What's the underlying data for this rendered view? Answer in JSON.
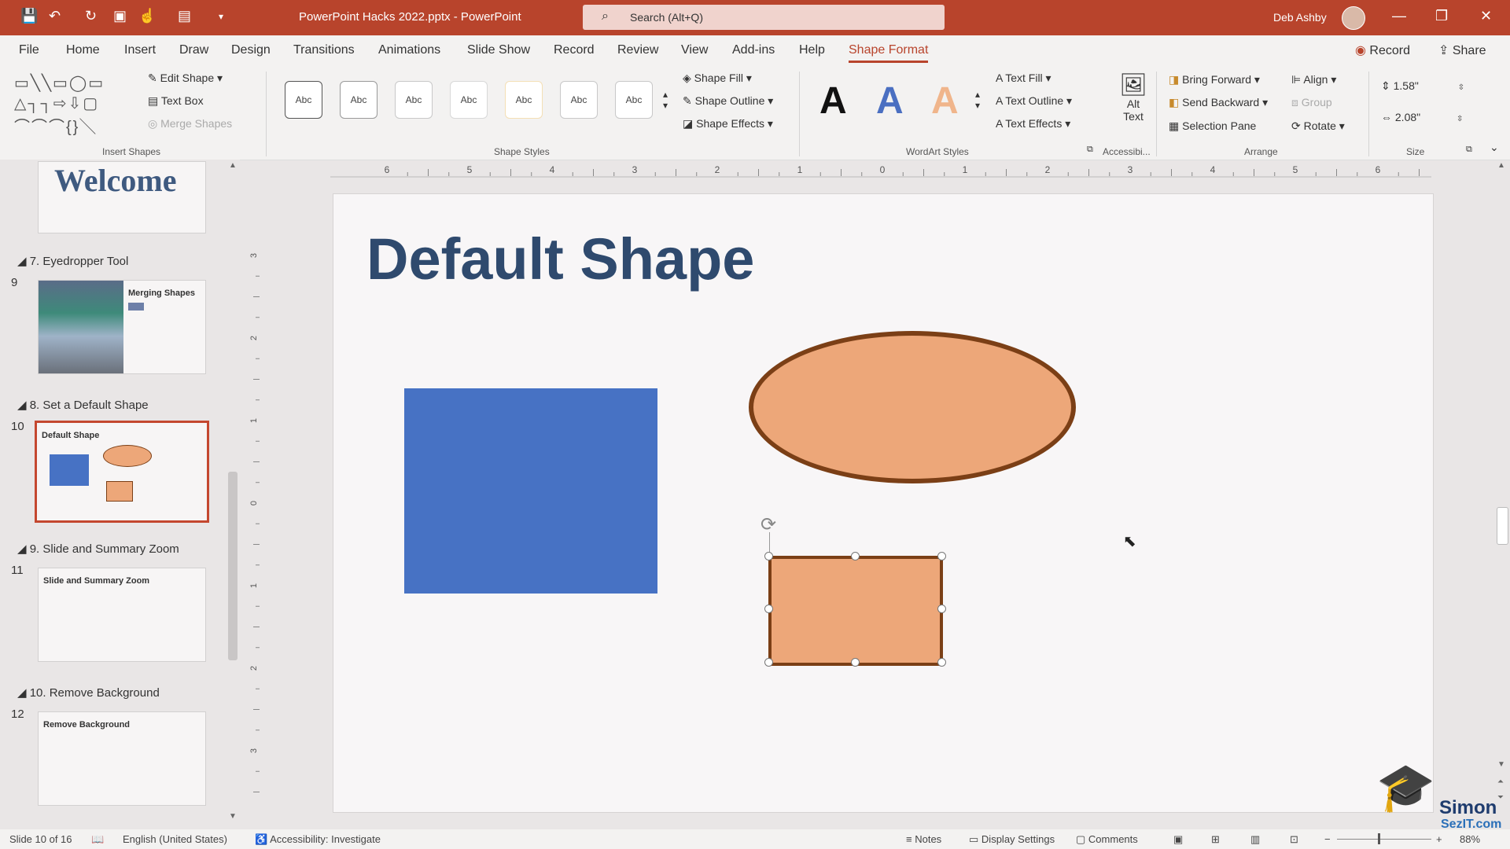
{
  "titlebar": {
    "document_title": "PowerPoint Hacks 2022.pptx  -  PowerPoint",
    "search_placeholder": "Search (Alt+Q)",
    "user_name": "Deb Ashby",
    "minimize": "—",
    "restore": "❐",
    "close": "✕"
  },
  "menu": {
    "items": [
      "File",
      "Home",
      "Insert",
      "Draw",
      "Design",
      "Transitions",
      "Animations",
      "Slide Show",
      "Record",
      "Review",
      "View",
      "Add-ins",
      "Help",
      "Shape Format"
    ],
    "active": "Shape Format",
    "record_label": "Record",
    "share_label": "Share"
  },
  "ribbon": {
    "insert_shapes": {
      "label": "Insert Shapes",
      "edit_shape": "Edit Shape",
      "text_box": "Text Box",
      "merge_shapes": "Merge Shapes"
    },
    "shape_styles": {
      "label": "Shape Styles",
      "sample": "Abc",
      "shape_fill": "Shape Fill",
      "shape_outline": "Shape Outline",
      "shape_effects": "Shape Effects"
    },
    "wordart": {
      "label": "WordArt Styles",
      "letter": "A",
      "text_fill": "Text Fill",
      "text_outline": "Text Outline",
      "text_effects": "Text Effects"
    },
    "accessibility": {
      "label": "Accessibi...",
      "alt_text_line1": "Alt",
      "alt_text_line2": "Text"
    },
    "arrange": {
      "label": "Arrange",
      "bring_forward": "Bring Forward",
      "send_backward": "Send Backward",
      "selection_pane": "Selection Pane",
      "align": "Align",
      "group": "Group",
      "rotate": "Rotate"
    },
    "size": {
      "label": "Size",
      "height": "1.58\"",
      "width": "2.08\""
    }
  },
  "slides_panel": {
    "first_thumb_text": "Welcome",
    "sections": [
      {
        "section": "7. Eyedropper Tool",
        "number": "9",
        "thumb_title": "Merging Shapes"
      },
      {
        "section": "8. Set a Default Shape",
        "number": "10",
        "thumb_title": "Default Shape"
      },
      {
        "section": "9. Slide and Summary Zoom",
        "number": "11",
        "thumb_title": "Slide and Summary Zoom"
      },
      {
        "section": "10. Remove Background",
        "number": "12",
        "thumb_title": "Remove Background"
      }
    ]
  },
  "ruler": {
    "h_ticks": [
      "6",
      "5",
      "4",
      "3",
      "2",
      "1",
      "0",
      "1",
      "2",
      "3",
      "4",
      "5",
      "6"
    ],
    "v_ticks": [
      "3",
      "2",
      "1",
      "0",
      "1",
      "2",
      "3"
    ]
  },
  "slide": {
    "title": "Default Shape"
  },
  "colors": {
    "accent": "#b8442c",
    "blue_shape": "#4772c4",
    "orange_shape": "#eda779",
    "outline": "#7b3f16",
    "title_text": "#2f4a6e"
  },
  "statusbar": {
    "slide_counter": "Slide 10 of 16",
    "language": "English (United States)",
    "accessibility": "Accessibility: Investigate",
    "notes": "Notes",
    "display_settings": "Display Settings",
    "comments": "Comments",
    "zoom": "88%"
  },
  "watermark": {
    "line1": "Simon",
    "line2": "SezIT.com"
  }
}
